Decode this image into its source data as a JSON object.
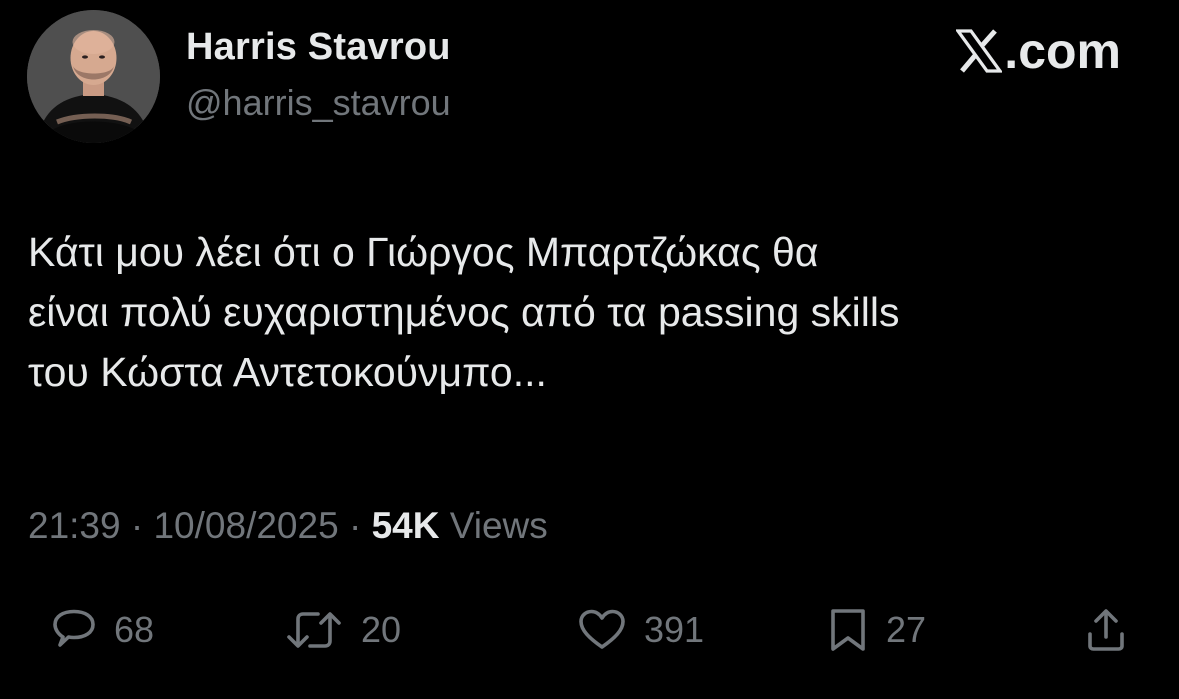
{
  "author": {
    "display_name": "Harris Stavrou",
    "handle": "@harris_stavrou",
    "avatar_icon": "profile-photo"
  },
  "brand": {
    "logo_icon": "x-logo-icon",
    "text": ".com"
  },
  "tweet": {
    "lines": [
      "Κάτι μου λέει ότι ο Γιώργος Μπαρτζώκας θα",
      "είναι πολύ ευχαριστημένος από τα passing skills",
      "του Κώστα Αντετοκούνμπο..."
    ]
  },
  "meta": {
    "time": "21:39",
    "separator": "·",
    "date": "10/08/2025",
    "views_count": "54K",
    "views_label": "Views"
  },
  "actions": {
    "replies": "68",
    "reposts": "20",
    "likes": "391",
    "bookmarks": "27"
  },
  "colors": {
    "background": "#000000",
    "primary_text": "#e7e9ea",
    "secondary_text": "#71767b"
  }
}
